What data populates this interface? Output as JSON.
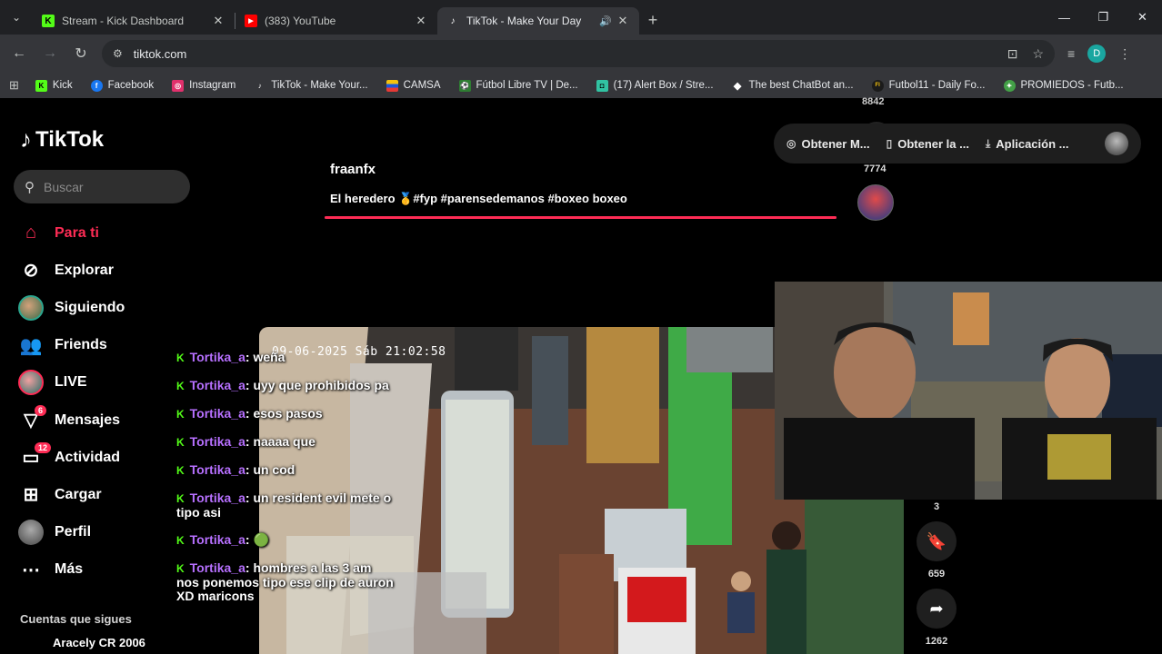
{
  "browser": {
    "tabs": [
      {
        "title": "Stream - Kick Dashboard",
        "icon": "kick-icon",
        "active": false
      },
      {
        "title": "(383) YouTube",
        "icon": "youtube-icon",
        "active": false
      },
      {
        "title": "TikTok - Make Your Day",
        "icon": "tiktok-icon",
        "active": true
      }
    ],
    "url": "tiktok.com",
    "profile_initial": "D",
    "bookmarks": [
      {
        "label": "Kick",
        "color": "#53fc18"
      },
      {
        "label": "Facebook",
        "color": "#1877f2"
      },
      {
        "label": "Instagram",
        "color": "#e1306c"
      },
      {
        "label": "TikTok - Make Your...",
        "color": "#000000"
      },
      {
        "label": "CAMSA",
        "color": "#f4c20d"
      },
      {
        "label": "Fútbol Libre TV | De...",
        "color": "#2e7d32"
      },
      {
        "label": "(17) Alert Box / Stre...",
        "color": "#31c3a2"
      },
      {
        "label": "The best ChatBot an...",
        "color": "#ffffff"
      },
      {
        "label": "Futbol11 - Daily Fo...",
        "color": "#1b1b1b"
      },
      {
        "label": "PROMIEDOS - Futb...",
        "color": "#43a047"
      }
    ]
  },
  "tiktok": {
    "logo": "TikTok",
    "search_placeholder": "Buscar",
    "menu": [
      {
        "label": "Para ti",
        "icon": "home-icon",
        "active": true
      },
      {
        "label": "Explorar",
        "icon": "compass-icon"
      },
      {
        "label": "Siguiendo",
        "icon": "following-avatar-icon"
      },
      {
        "label": "Friends",
        "icon": "friends-icon"
      },
      {
        "label": "LIVE",
        "icon": "live-avatar-icon"
      },
      {
        "label": "Mensajes",
        "icon": "inbox-icon",
        "badge": "6"
      },
      {
        "label": "Actividad",
        "icon": "activity-icon",
        "badge": "12"
      },
      {
        "label": "Cargar",
        "icon": "upload-icon"
      },
      {
        "label": "Perfil",
        "icon": "profile-avatar-icon"
      },
      {
        "label": "Más",
        "icon": "more-icon"
      }
    ],
    "following_heading": "Cuentas que sigues",
    "following_first": "Aracely CR 2006",
    "top_pill": {
      "item1": "Obtener M...",
      "item2": "Obtener la ...",
      "item3": "Aplicación ..."
    },
    "video": {
      "author": "fraanfx",
      "description": "El heredero  🥇#fyp #parensedemanos #boxeo boxeo",
      "progress_percent": 100,
      "top_count": "8842",
      "share_count": "7774"
    },
    "next_video_counts": {
      "likes_partial": "3",
      "saves": "659",
      "shares": "1262"
    }
  },
  "stream_overlay": {
    "cctv_timestamp": "09-06-2025 Sáb  21:02:58",
    "chat": [
      {
        "user": "Tortika_a",
        "message": ": weña"
      },
      {
        "user": "Tortika_a",
        "message": ": uyy que prohibidos pa"
      },
      {
        "user": "Tortika_a",
        "message": ": esos pasos"
      },
      {
        "user": "Tortika_a",
        "message": ": naaaa que"
      },
      {
        "user": "Tortika_a",
        "message": ": un cod"
      },
      {
        "user": "Tortika_a",
        "message": ": un resident evil mete o tipo asi"
      },
      {
        "user": "Tortika_a",
        "message": ": 🟢"
      },
      {
        "user": "Tortika_a",
        "message": ": hombres a las 3 am nos ponemos tipo ese clip de auron XD   maricons"
      }
    ]
  }
}
